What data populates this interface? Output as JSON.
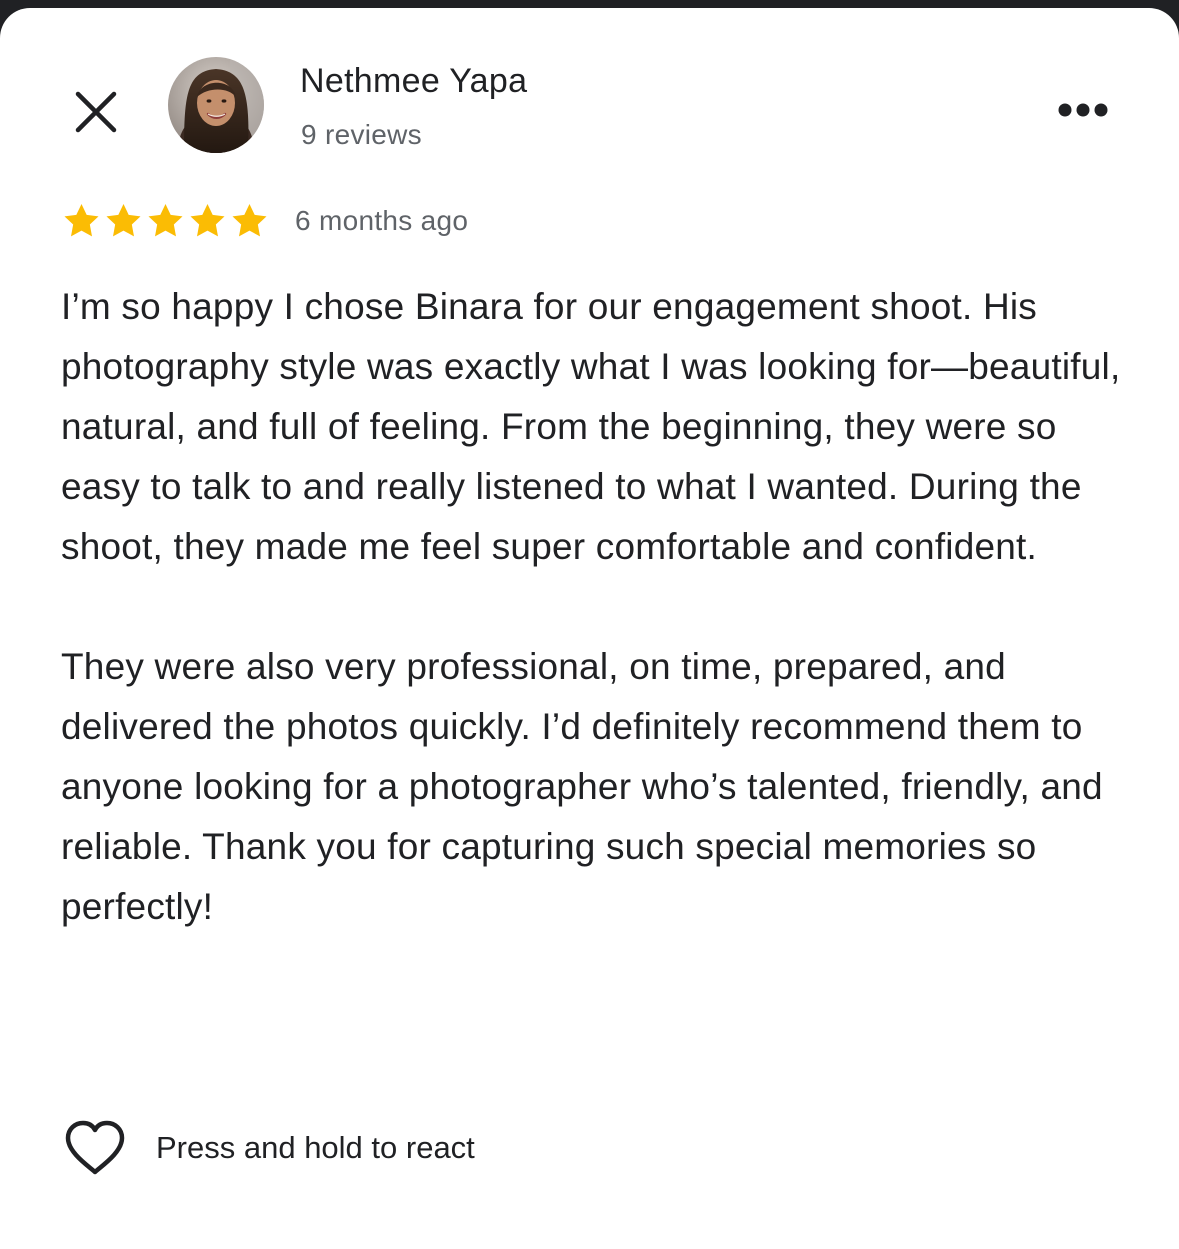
{
  "review": {
    "author_name": "Nethmee Yapa",
    "author_reviews": "9 reviews",
    "rating": 5,
    "rating_max": 5,
    "time_ago": "6 months ago",
    "text_paragraphs": [
      "I’m so happy I chose Binara for our engagement shoot. His photography style was exactly what I was looking for—beautiful, natural, and full of feeling. From the beginning, they were so easy to talk to and really listened to what I wanted. During the shoot, they made me feel super comfortable and confident.",
      "They were also very professional, on time, prepared, and delivered the photos quickly. I’d definitely recommend them to anyone looking for a photographer who’s talented, friendly, and reliable. Thank you for capturing such special memories so perfectly!"
    ],
    "react_label": "Press and hold to react"
  },
  "icons": {
    "close": "close-icon",
    "more": "more-options-icon",
    "star": "star-icon",
    "heart": "heart-outline-icon",
    "avatar": "profile-photo"
  },
  "colors": {
    "star": "#FBBC04",
    "text_primary": "#202124",
    "text_secondary": "#5f6368",
    "background": "#ffffff",
    "top_bar": "#202124"
  }
}
